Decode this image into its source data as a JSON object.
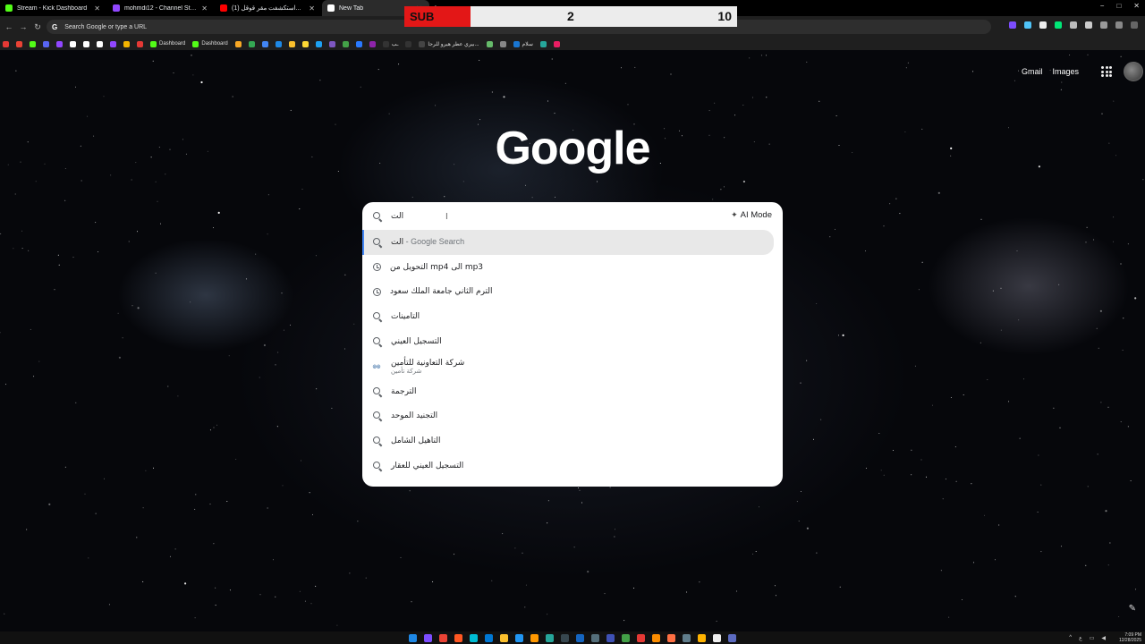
{
  "tabs": [
    {
      "title": "Stream - Kick Dashboard",
      "color": "#53fc18"
    },
    {
      "title": "mohmdi12 - Channel Streams",
      "color": "#9147ff"
    },
    {
      "title": "(1) استكشفت مقر قوقل...",
      "color": "#ff0000"
    },
    {
      "title": "New Tab",
      "color": "#ffffff",
      "active": true
    }
  ],
  "window_controls": {
    "minimize": "−",
    "maximize": "□",
    "close": "✕"
  },
  "scoreboard": {
    "label": "SUB",
    "current": "2",
    "goal": "10"
  },
  "toolbar": {
    "omnibox_placeholder": "Search Google or type a URL",
    "omnibox_g": "G"
  },
  "bookmarks": [
    {
      "label": "",
      "color": "#e53935"
    },
    {
      "label": "",
      "color": "#ea4335"
    },
    {
      "label": "",
      "color": "#53fc18"
    },
    {
      "label": "",
      "color": "#5865f2"
    },
    {
      "label": "",
      "color": "#9147ff"
    },
    {
      "label": "",
      "color": "#ffffff"
    },
    {
      "label": "",
      "color": "#ffffff"
    },
    {
      "label": "",
      "color": "#ffffff"
    },
    {
      "label": "",
      "color": "#9147ff"
    },
    {
      "label": "",
      "color": "#f4b400"
    },
    {
      "label": "",
      "color": "#e53935"
    },
    {
      "label": "Dashboard",
      "color": "#53fc18"
    },
    {
      "label": "Dashboard",
      "color": "#53fc18"
    },
    {
      "label": "",
      "color": "#f9a825"
    },
    {
      "label": "",
      "color": "#34a853"
    },
    {
      "label": "",
      "color": "#4285f4"
    },
    {
      "label": "",
      "color": "#1e88e5"
    },
    {
      "label": "",
      "color": "#fbc02d"
    },
    {
      "label": "",
      "color": "#fdd835"
    },
    {
      "label": "",
      "color": "#1da1f2"
    },
    {
      "label": "",
      "color": "#7e57c2"
    },
    {
      "label": "",
      "color": "#43a047"
    },
    {
      "label": "",
      "color": "#2979ff"
    },
    {
      "label": "",
      "color": "#8e24aa"
    },
    {
      "label": "ـب",
      "color": "#333333"
    },
    {
      "label": "",
      "color": "#333333"
    },
    {
      "label": "بيري عطر هيرو للرجا...",
      "color": "#444444"
    },
    {
      "label": "",
      "color": "#66bb6a"
    },
    {
      "label": "",
      "color": "#888888"
    },
    {
      "label": "سلام",
      "color": "#1976d2"
    },
    {
      "label": "",
      "color": "#26a69a"
    },
    {
      "label": "",
      "color": "#e91e63"
    }
  ],
  "ntp": {
    "gmail": "Gmail",
    "images": "Images",
    "logo": "Google"
  },
  "search": {
    "query": "الت",
    "ai_mode": "AI Mode",
    "suggestions": [
      {
        "text": "الت",
        "suffix": " - Google Search",
        "icon": "search-icon",
        "selected": true
      },
      {
        "text": "التحويل من mp4 الى mp3",
        "suffix": "",
        "icon": "history-icon"
      },
      {
        "text": "الترم الثاني جامعة الملك سعود",
        "suffix": "",
        "icon": "history-icon"
      },
      {
        "text": "التامينات",
        "suffix": "",
        "icon": "search-icon"
      },
      {
        "text": "التسجيل العيني",
        "suffix": "",
        "icon": "search-icon"
      },
      {
        "text": "شركة التعاونية للتأمين",
        "sub": "شركة تأمين",
        "icon": "entity-logo"
      },
      {
        "text": "الترجمة",
        "suffix": "",
        "icon": "search-icon"
      },
      {
        "text": "التجنيد الموحد",
        "suffix": "",
        "icon": "search-icon"
      },
      {
        "text": "التاهيل الشامل",
        "suffix": "",
        "icon": "search-icon"
      },
      {
        "text": "التسجيل العيني للعقار",
        "suffix": "",
        "icon": "search-icon"
      }
    ]
  },
  "taskbar": {
    "icons": [
      "#1e88e5",
      "#7c4dff",
      "#ea4335",
      "#ff5722",
      "#00bcd4",
      "#0078d4",
      "#fbc02d",
      "#2196f3",
      "#ff9800",
      "#26a69a",
      "#37474f",
      "#1565c0",
      "#546e7a",
      "#3f51b5",
      "#43a047",
      "#e53935",
      "#fb8c00",
      "#ff7043",
      "#607d8b",
      "#ffb300",
      "#eeeeee",
      "#5c6bc0"
    ],
    "time": "7:09 PM",
    "date": "12/28/2025",
    "lang": "ع"
  }
}
